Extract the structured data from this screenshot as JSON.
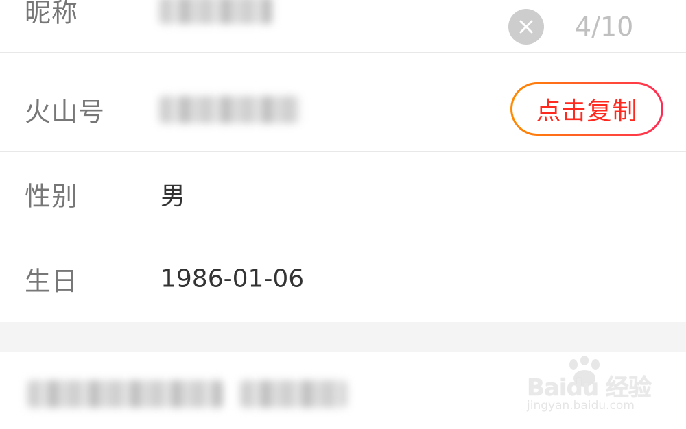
{
  "profile": {
    "nickname": {
      "label": "昵称",
      "counter": "4/10"
    },
    "huoshan_id": {
      "label": "火山号",
      "copy_button": "点击复制"
    },
    "gender": {
      "label": "性别",
      "value": "男"
    },
    "birthday": {
      "label": "生日",
      "value": "1986-01-06"
    }
  },
  "watermark": {
    "brand": "Baidu 经验",
    "url": "jingyan.baidu.com"
  },
  "icons": {
    "clear": "close-icon",
    "watermark": "baidu-paw-icon"
  },
  "colors": {
    "copy_text": "#ff2a1f",
    "gradient_start": "#ff8a00",
    "gradient_end": "#ff2c55",
    "label": "#777777",
    "counter": "#c0c0c0"
  }
}
